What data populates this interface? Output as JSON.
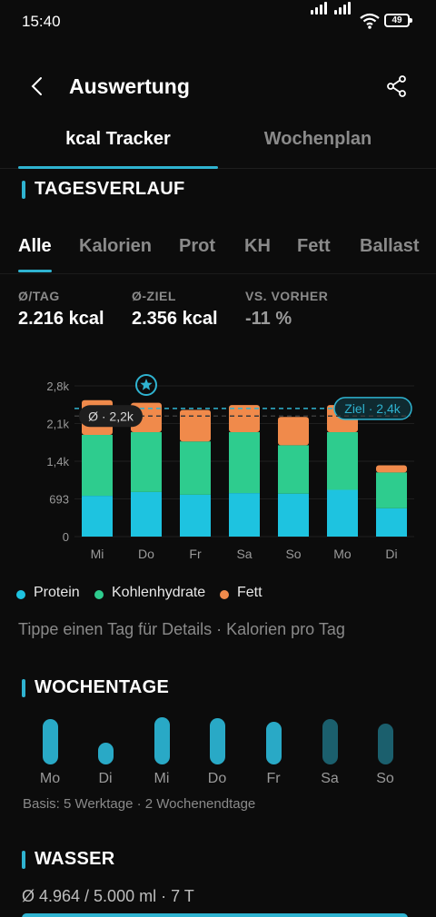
{
  "status": {
    "time": "15:40",
    "battery": "49"
  },
  "header": {
    "title": "Auswertung"
  },
  "tabs": [
    {
      "label": "kcal Tracker",
      "active": true
    },
    {
      "label": "Wochenplan",
      "active": false
    }
  ],
  "sections": {
    "daily": "TAGESVERLAUF",
    "weekdays": "WOCHENTAGE",
    "water": "WASSER"
  },
  "filters": [
    {
      "label": "Alle",
      "active": true
    },
    {
      "label": "Kalorien",
      "active": false
    },
    {
      "label": "Prot",
      "active": false
    },
    {
      "label": "KH",
      "active": false
    },
    {
      "label": "Fett",
      "active": false
    },
    {
      "label": "Ballast",
      "active": false
    }
  ],
  "stats": [
    {
      "label": "Ø/TAG",
      "value": "2.216 kcal",
      "muted": false
    },
    {
      "label": "Ø-ZIEL",
      "value": "2.356 kcal",
      "muted": false
    },
    {
      "label": "VS. VORHER",
      "value": "-11 %",
      "muted": true
    }
  ],
  "chart_data": {
    "type": "bar",
    "stacked": true,
    "categories": [
      "Mi",
      "Do",
      "Fr",
      "Sa",
      "So",
      "Mo",
      "Di"
    ],
    "series": [
      {
        "name": "Protein",
        "color": "#1ec3e0",
        "values": [
          750,
          820,
          770,
          800,
          790,
          860,
          520
        ]
      },
      {
        "name": "Kohlenhydrate",
        "color": "#2ecc8e",
        "values": [
          1120,
          1100,
          980,
          1120,
          890,
          1060,
          660
        ]
      },
      {
        "name": "Fett",
        "color": "#f08a4b",
        "values": [
          640,
          540,
          580,
          500,
          520,
          500,
          130
        ]
      }
    ],
    "y_ticks": [
      "0",
      "693",
      "1,4k",
      "2,1k",
      "2,8k"
    ],
    "y_tick_values": [
      0,
      693,
      1386,
      2079,
      2772
    ],
    "ylim": [
      0,
      2772
    ],
    "average": {
      "value": 2216,
      "label": "Ø · 2,2k"
    },
    "goal": {
      "value": 2356,
      "label": "Ziel · 2,4k"
    },
    "highlighted_day": "Do",
    "star_icon": "star-icon",
    "grid": true,
    "legend": "bottom"
  },
  "hint": "Tippe einen Tag für Details · Kalorien pro Tag",
  "weekdays": {
    "days": [
      {
        "label": "Mo",
        "level": 0.82,
        "color": "#29a9c6"
      },
      {
        "label": "Di",
        "level": 0.4,
        "color": "#29a9c6"
      },
      {
        "label": "Mi",
        "level": 0.85,
        "color": "#29a9c6"
      },
      {
        "label": "Do",
        "level": 0.84,
        "color": "#29a9c6"
      },
      {
        "label": "Fr",
        "level": 0.77,
        "color": "#29a9c6"
      },
      {
        "label": "Sa",
        "level": 0.82,
        "color": "#1b5f6d"
      },
      {
        "label": "So",
        "level": 0.74,
        "color": "#1b5f6d"
      }
    ],
    "basis": "Basis: 5 Werktage · 2 Wochenendtage"
  },
  "water": {
    "summary": "Ø 4.964 / 5.000 ml · 7 T",
    "progress": 0.993
  }
}
